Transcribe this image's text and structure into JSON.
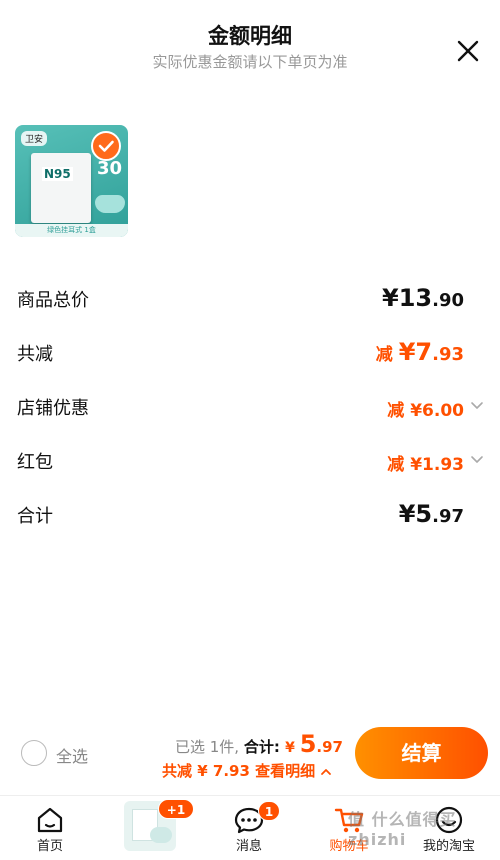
{
  "header": {
    "title": "金额明细",
    "subtitle": "实际优惠金额请以下单页为准"
  },
  "product": {
    "brand": "卫安",
    "model": "N95",
    "count": "30",
    "strip": "绿色挂耳式 1盒",
    "selected": true
  },
  "rows": {
    "total_price": {
      "label": "商品总价",
      "int": "¥13",
      "dec": ".90"
    },
    "total_reduce": {
      "label": "共减",
      "prefix": "减 ",
      "int": "¥7",
      "dec": ".93"
    },
    "shop_discount": {
      "label": "店铺优惠",
      "prefix": "减 ",
      "value": "¥6.00"
    },
    "red_packet": {
      "label": "红包",
      "prefix": "减 ",
      "value": "¥1.93"
    },
    "subtotal": {
      "label": "合计",
      "int": "¥5",
      "dec": ".97"
    }
  },
  "action_bar": {
    "select_all_label": "全选",
    "selected_count": "已选 1件, ",
    "total_label": "合计: ",
    "yen": "¥ ",
    "total_int": "5",
    "total_dec": ".97",
    "discount_text": "共减 ¥ 7.93  查看明细",
    "settle_label": "结算"
  },
  "tabbar": {
    "home": "首页",
    "messages": "消息",
    "messages_badge": "1",
    "cart": "购物车",
    "me": "我的淘宝",
    "cart_add_badge": "+1"
  },
  "watermark": "值 什么值得买 zhizhi",
  "colors": {
    "accent": "#ff5000",
    "accent_start": "#ff9000",
    "muted": "#999999"
  }
}
